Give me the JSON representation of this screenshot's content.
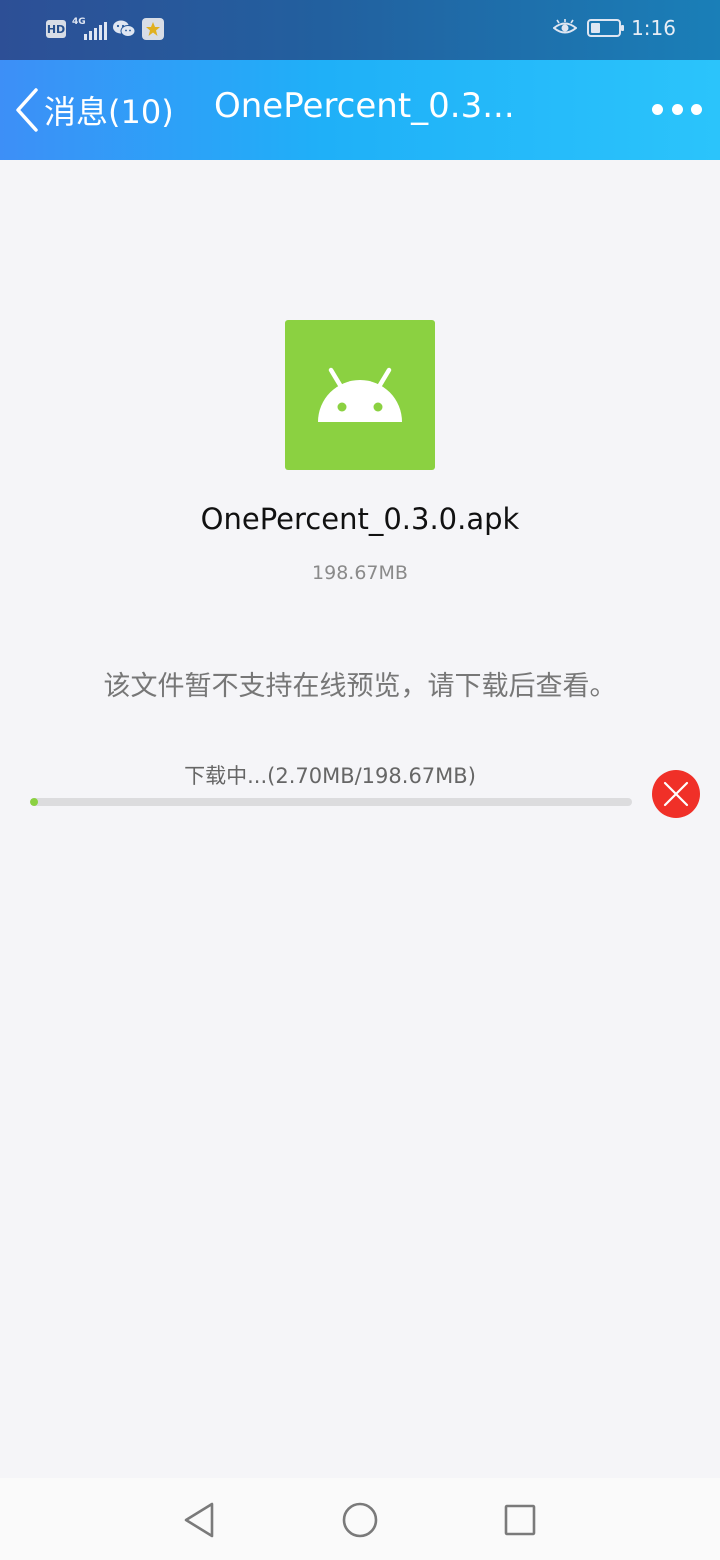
{
  "status_bar": {
    "hd_label": "HD",
    "network_label": "4G",
    "time": "1:16",
    "icons": [
      "hd-icon",
      "signal-icon",
      "wechat-icon",
      "star-icon",
      "eye-comfort-icon",
      "battery-icon"
    ]
  },
  "header": {
    "back_label": "消息(10)",
    "title": "OnePercent_0.3...",
    "icons": [
      "back-chevron-icon",
      "more-icon"
    ]
  },
  "file": {
    "icon": "android-icon",
    "icon_color": "#8bd141",
    "name": "OnePercent_0.3.0.apk",
    "size": "198.67MB"
  },
  "notice": "该文件暂不支持在线预览，请下载后查看。",
  "download": {
    "status_text": "下载中...(2.70MB/198.67MB)",
    "progress": 0.0136,
    "cancel_icon": "close-icon",
    "cancel_color": "#f03028"
  },
  "nav_bar": {
    "icons": [
      "back-triangle-icon",
      "home-circle-icon",
      "recents-square-icon"
    ]
  },
  "colors": {
    "accent": "#1fb0f8",
    "background": "#f5f5f8"
  }
}
